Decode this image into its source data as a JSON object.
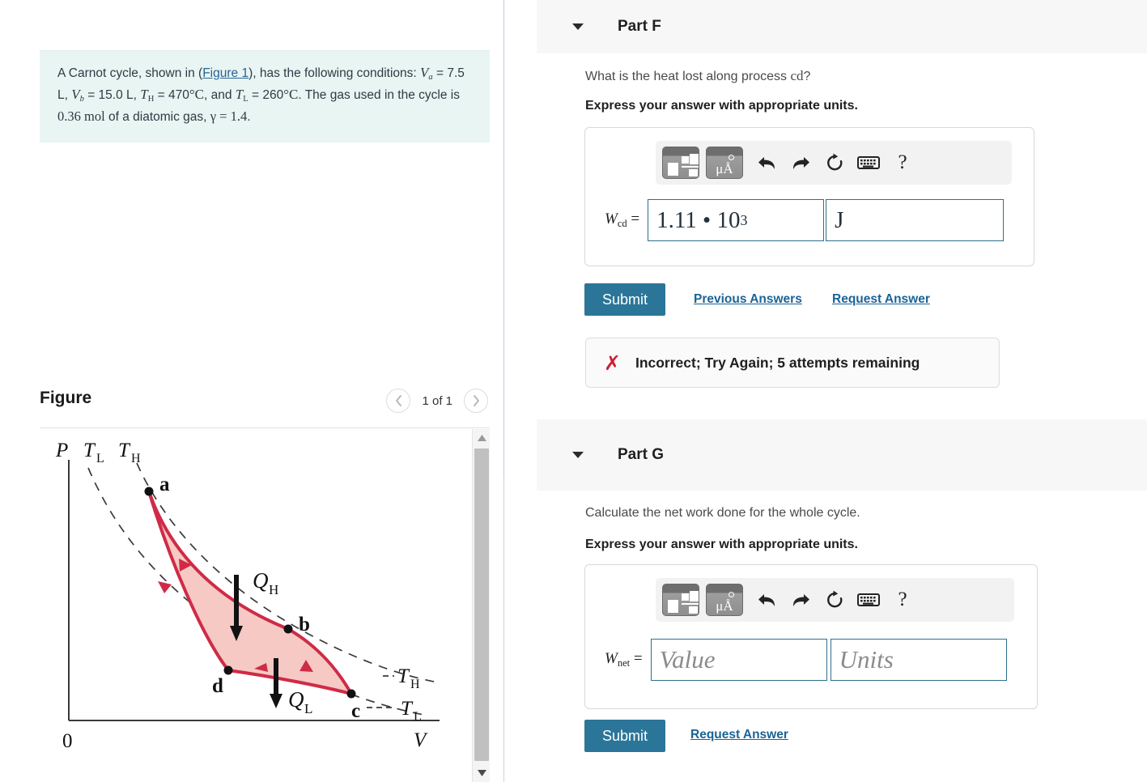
{
  "problem": {
    "intro_a": "A Carnot cycle, shown in (",
    "figure_link": "Figure 1",
    "intro_b": "), has the following conditions: ",
    "va_symbol": "V",
    "va_sub": "a",
    "va_eq": " = 7.5 L, ",
    "vb_symbol": "V",
    "vb_sub": "b",
    "vb_eq": " = 15.0 L, ",
    "th_symbol": "T",
    "th_sub": "H",
    "th_eq": " = 470",
    "deg_c": "°C",
    "and_text": ", and ",
    "tl_symbol": "T",
    "tl_sub": "L",
    "tl_eq": " = 260",
    "tail_1": ". The gas used in the cycle is ",
    "moles": "0.36 mol",
    "tail_2": " of a diatomic gas, ",
    "gamma": "γ = 1.4",
    "tail_3": "."
  },
  "figure": {
    "title": "Figure",
    "prev_icon": "chevron-left-icon",
    "next_icon": "chevron-right-icon",
    "counter": "1 of 1",
    "scroll_up_icon": "triangle-up-icon",
    "scroll_down_icon": "triangle-down-icon",
    "diagram": {
      "y_axis_label": "P",
      "curve_label_tl_top": "T",
      "curve_label_tl_top_sub": "L",
      "curve_label_th_top": "T",
      "curve_label_th_top_sub": "H",
      "origin_label": "0",
      "x_axis_label": "V",
      "point_a": "a",
      "point_b": "b",
      "point_c": "c",
      "point_d": "d",
      "heat_in": "Q",
      "heat_in_sub": "H",
      "heat_out": "Q",
      "heat_out_sub": "L",
      "iso_th_right": "T",
      "iso_th_right_sub": "H",
      "iso_tl_right": "T",
      "iso_tl_right_sub": "L",
      "cycle_fill": "#f6c9c4",
      "cycle_stroke": "#cf2b46"
    }
  },
  "parts": [
    {
      "id": "part-f",
      "header": "Part F",
      "caret_icon": "caret-down-icon",
      "question": "What is the heat lost along process cd?",
      "instruction": "Express your answer with appropriate units.",
      "answer_label_symbol": "W",
      "answer_label_sub": "cd",
      "answer_label_eq": "=",
      "value": "1.11 • 10",
      "value_exponent": "3",
      "units": "J",
      "toolbar": {
        "template_button": "math-template-button",
        "units_button": "units-button",
        "units_glyph": "μÅ",
        "undo_icon": "undo-icon",
        "redo_icon": "redo-icon",
        "reset_icon": "reset-icon",
        "keyboard_icon": "keyboard-icon",
        "help_icon": "help-icon"
      },
      "submit_label": "Submit",
      "links": [
        "Previous Answers",
        "Request Answer"
      ],
      "feedback": {
        "icon": "red-x-icon",
        "text": "Incorrect; Try Again; 5 attempts remaining"
      }
    },
    {
      "id": "part-g",
      "header": "Part G",
      "caret_icon": "caret-down-icon",
      "question": "Calculate the net work done for the whole cycle.",
      "instruction": "Express your answer with appropriate units.",
      "answer_label_symbol": "W",
      "answer_label_sub": "net",
      "answer_label_eq": "=",
      "value_placeholder": "Value",
      "units_placeholder": "Units",
      "toolbar": {
        "template_button": "math-template-button",
        "units_button": "units-button",
        "units_glyph": "μÅ",
        "undo_icon": "undo-icon",
        "redo_icon": "redo-icon",
        "reset_icon": "reset-icon",
        "keyboard_icon": "keyboard-icon",
        "help_icon": "help-icon"
      },
      "submit_label": "Submit",
      "links": [
        "Request Answer"
      ]
    }
  ],
  "colors": {
    "accent": "#2b7698",
    "link": "#1a6496",
    "problem_bg": "#e8f5f2",
    "band_bg": "#f7f7f7",
    "error": "#d01f2e",
    "input_border": "#2e6f8e"
  }
}
